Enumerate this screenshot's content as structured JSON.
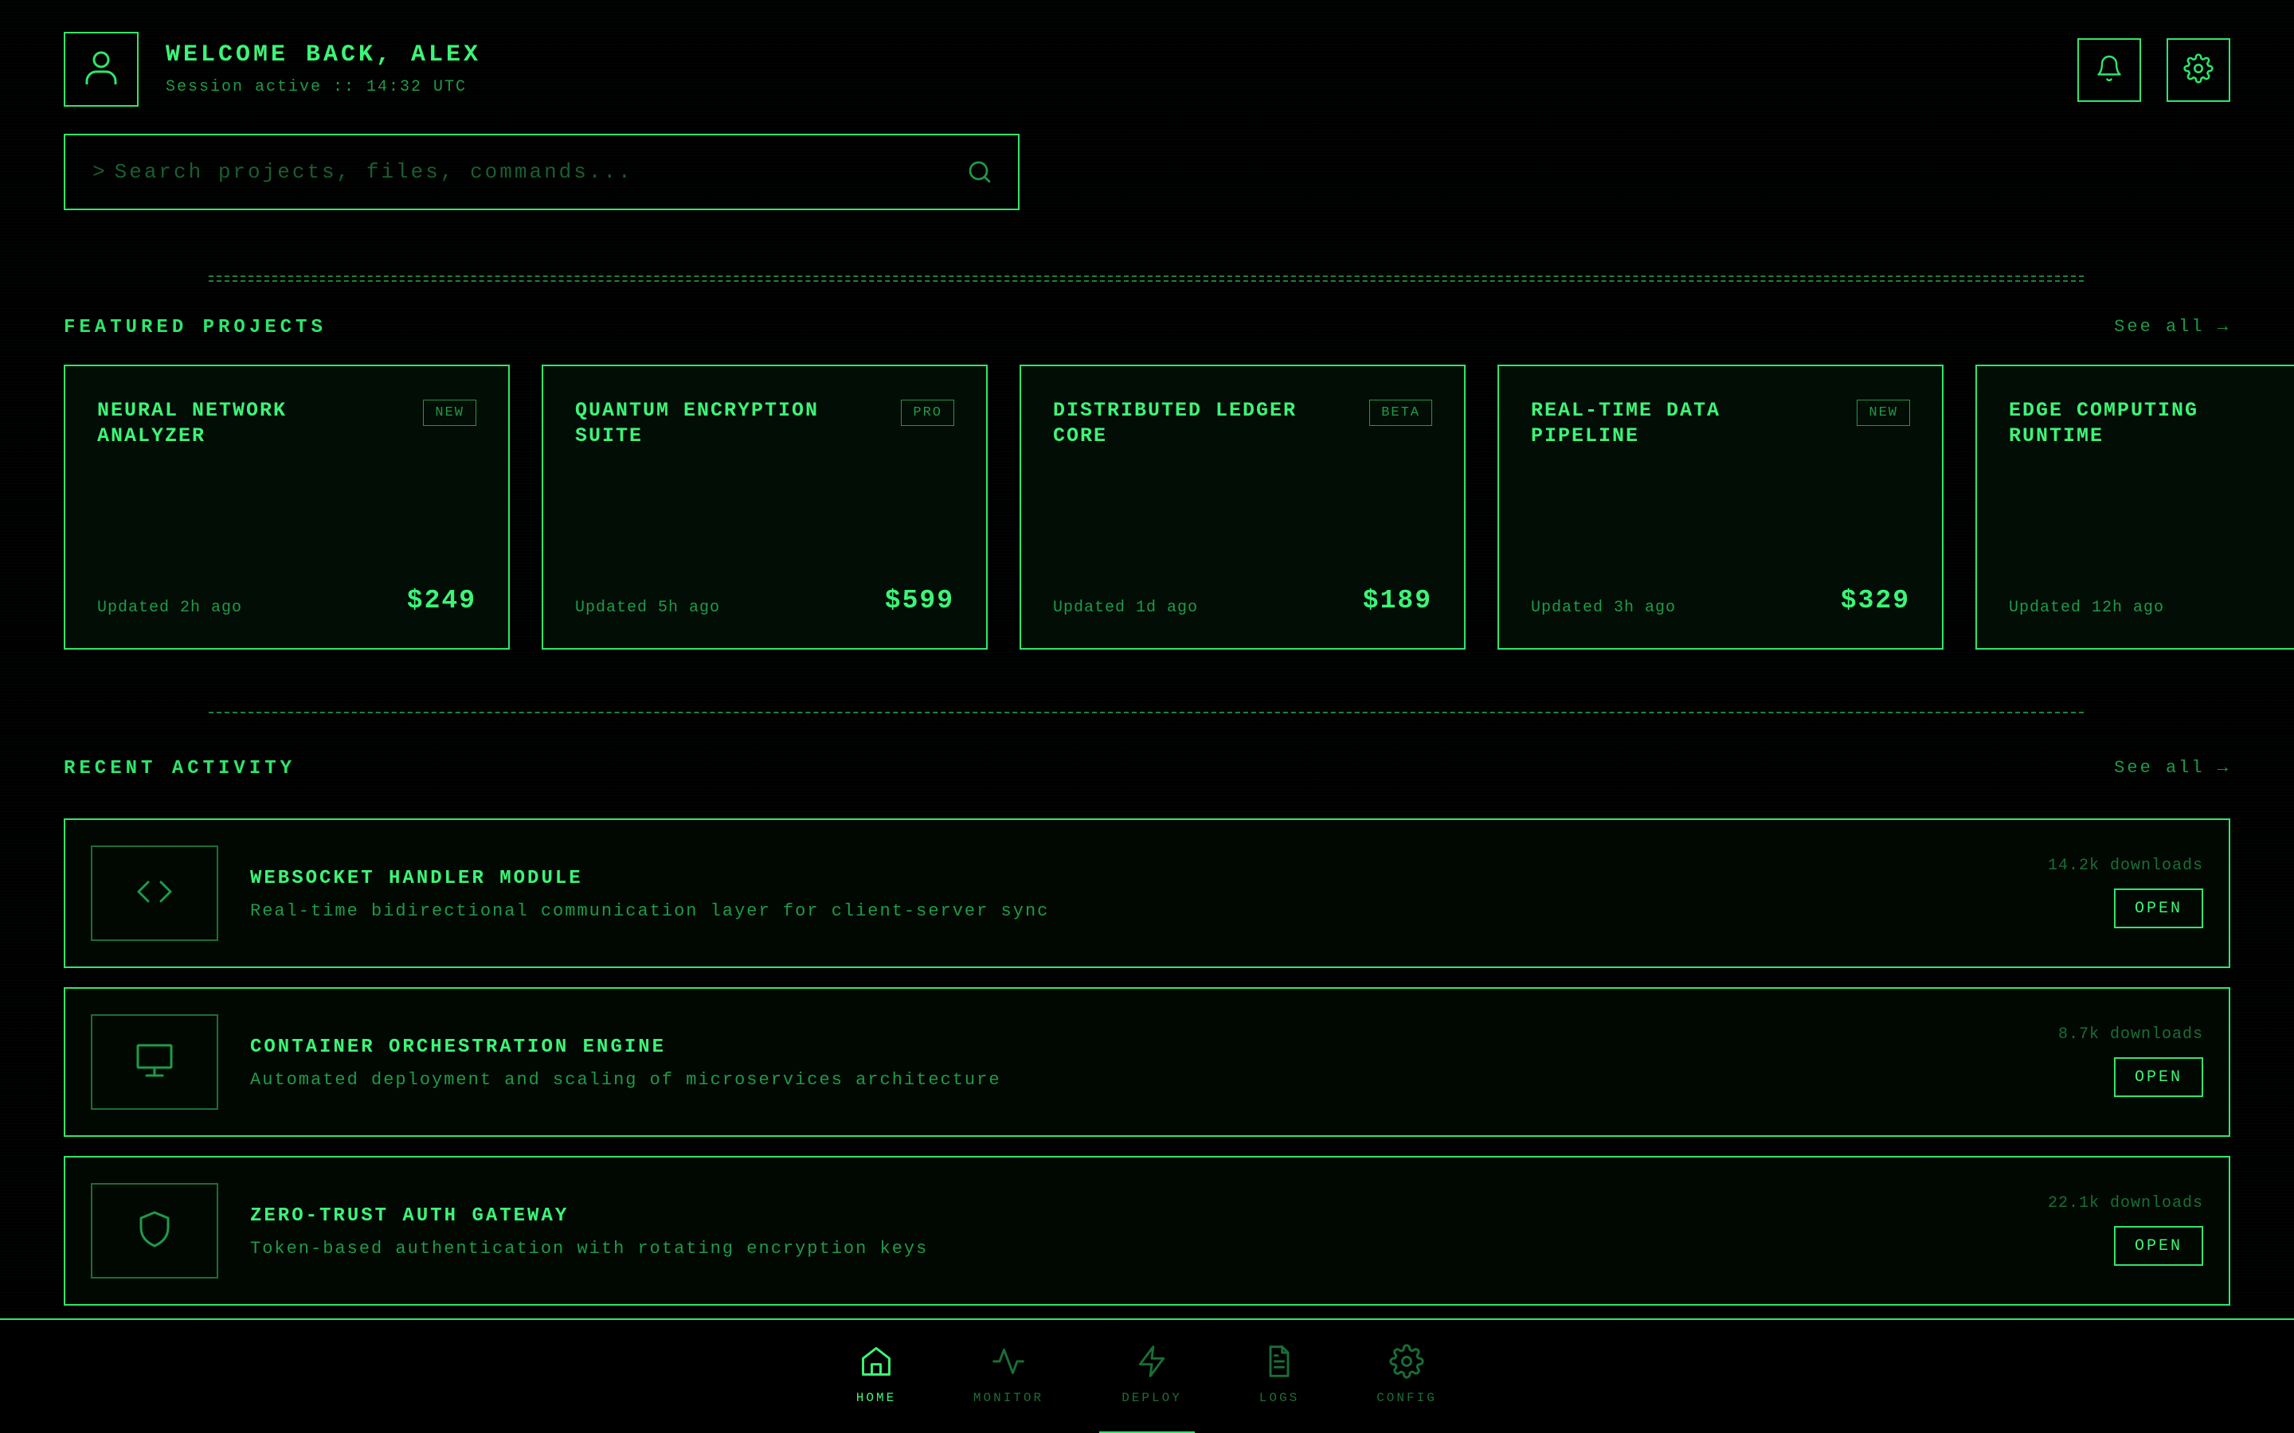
{
  "header": {
    "welcome": "WELCOME BACK, ALEX",
    "session": "Session active :: 14:32 UTC",
    "avatar_icon": "user-icon",
    "notification_icon": "bell-icon",
    "settings_icon": "gear-icon"
  },
  "search": {
    "prompt": ">",
    "placeholder": "Search projects, files, commands...",
    "value": "",
    "icon": "search-icon"
  },
  "featured": {
    "title": "FEATURED PROJECTS",
    "see_all": "See all →",
    "cards": [
      {
        "title": "NEURAL NETWORK ANALYZER",
        "badge": "NEW",
        "updated": "Updated 2h ago",
        "price": "$249"
      },
      {
        "title": "QUANTUM ENCRYPTION SUITE",
        "badge": "PRO",
        "updated": "Updated 5h ago",
        "price": "$599"
      },
      {
        "title": "DISTRIBUTED LEDGER CORE",
        "badge": "BETA",
        "updated": "Updated 1d ago",
        "price": "$189"
      },
      {
        "title": "REAL-TIME DATA PIPELINE",
        "badge": "NEW",
        "updated": "Updated 3h ago",
        "price": "$329"
      },
      {
        "title": "EDGE COMPUTING RUNTIME",
        "updated": "Updated 12h ago"
      }
    ]
  },
  "activity": {
    "title": "RECENT ACTIVITY",
    "see_all": "See all →",
    "items": [
      {
        "icon": "code-icon",
        "title": "WEBSOCKET HANDLER MODULE",
        "desc": "Real-time bidirectional communication layer for client-server sync",
        "downloads": "14.2k downloads",
        "action": "OPEN"
      },
      {
        "icon": "monitor-icon",
        "title": "CONTAINER ORCHESTRATION ENGINE",
        "desc": "Automated deployment and scaling of microservices architecture",
        "downloads": "8.7k downloads",
        "action": "OPEN"
      },
      {
        "icon": "shield-icon",
        "title": "ZERO-TRUST AUTH GATEWAY",
        "desc": "Token-based authentication with rotating encryption keys",
        "downloads": "22.1k downloads",
        "action": "OPEN"
      }
    ]
  },
  "nav": {
    "active": "DEPLOY",
    "items": [
      {
        "label": "HOME",
        "icon": "home-icon"
      },
      {
        "label": "MONITOR",
        "icon": "activity-icon"
      },
      {
        "label": "DEPLOY",
        "icon": "lightning-icon"
      },
      {
        "label": "LOGS",
        "icon": "file-icon"
      },
      {
        "label": "CONFIG",
        "icon": "gear-icon"
      }
    ]
  },
  "colors": {
    "background": "#000000",
    "accent": "#2ee66b",
    "accent_bright": "#3cf577",
    "muted": "#1f9a49",
    "dim": "#1a6e36"
  }
}
